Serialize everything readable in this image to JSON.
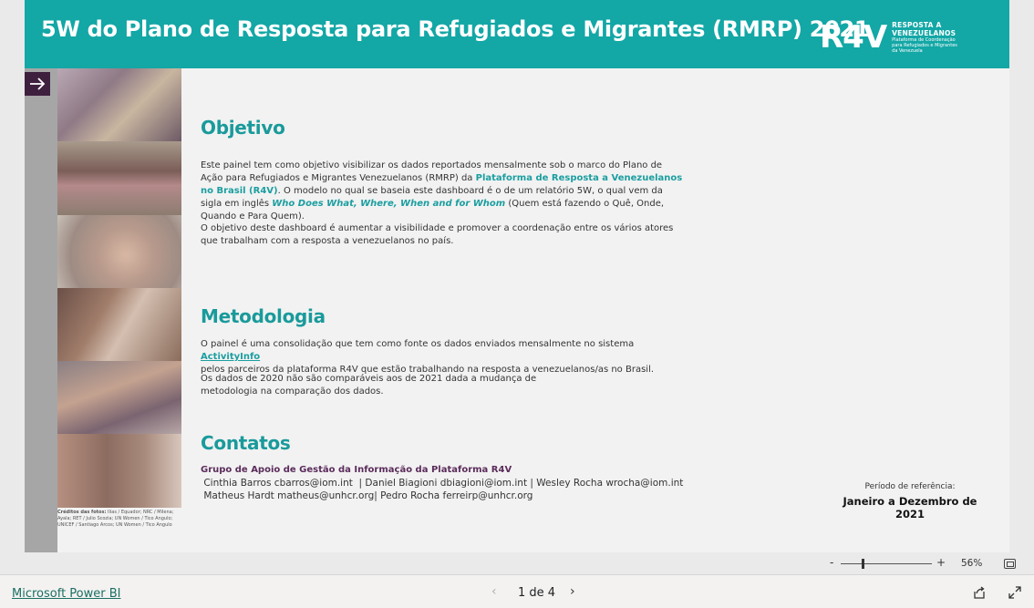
{
  "header": {
    "title": "5W do Plano de Resposta para Refugiados e Migrantes (RMRP) 2021",
    "logo_mark": "R4V",
    "logo_line1": "RESPOSTA A",
    "logo_line2": "VENEZUELANOS",
    "logo_small1": "Plataforma de Coordenação",
    "logo_small2": "para Refugiados e Migrantes",
    "logo_small3": "da Venezuela",
    "brand_color": "#13a7a6"
  },
  "nav_icon": "arrow-right-icon",
  "credits": {
    "label": "Créditos das fotos:",
    "text": "Ilias / Equador; NRC / Milena; Ayala; RET / Julio Scozia; UN Women / Tico Angulo; UNICEF / Santiago Arcos; UN Women / Tico Angulo"
  },
  "objetivo": {
    "title": "Objetivo",
    "p1_a": "Este painel tem como objetivo visibilizar os dados reportados mensalmente sob o marco do Plano de Ação para Refugiados e Migrantes Venezuelanos (RMRP) da ",
    "p1_highlight": "Plataforma de Resposta a Venezuelanos no Brasil (R4V)",
    "p1_b": ". O modelo no qual se baseia este dashboard é o de um relatório 5W, o qual vem da sigla em inglês ",
    "p1_italic": "Who Does What, Where, When and for Whom",
    "p1_c": " (Quem está fazendo o Quê, Onde, Quando e Para Quem).",
    "p2": "O objetivo deste dashboard é aumentar a visibilidade e promover a coordenação entre os vários atores que trabalham com a resposta a venezuelanos no país."
  },
  "metodologia": {
    "title": "Metodologia",
    "p1_a": "O painel é uma consolidação  que tem como fonte os dados enviados mensalmente no sistema ",
    "p1_link": "ActivityInfo ",
    "p1_b": "pelos parceiros da plataforma R4V que estão trabalhando na resposta a venezuelanos/as no Brasil.",
    "p2": "Os dados de 2020 não são comparáveis aos de 2021 dada a mudança de metodologia na comparação dos dados."
  },
  "contatos": {
    "title": "Contatos",
    "group": "Grupo de Apoio de Gestão da Informação da Plataforma R4V",
    "line1": " Cinthia Barros cbarros@iom.int  | Daniel Biagioni dbiagioni@iom.int | Wesley Rocha wrocha@iom.int",
    "line2": " Matheus Hardt matheus@unhcr.org| Pedro Rocha ferreirp@unhcr.org"
  },
  "period": {
    "label": "Período de referência:",
    "value": "Janeiro a Dezembro de 2021"
  },
  "zoom": {
    "minus": "-",
    "plus": "+",
    "value": "56%",
    "level_percent": 56
  },
  "bottom": {
    "powerbi_link": "Microsoft Power BI",
    "page_indicator": "1 de 4",
    "prev": "‹",
    "next": "›"
  }
}
